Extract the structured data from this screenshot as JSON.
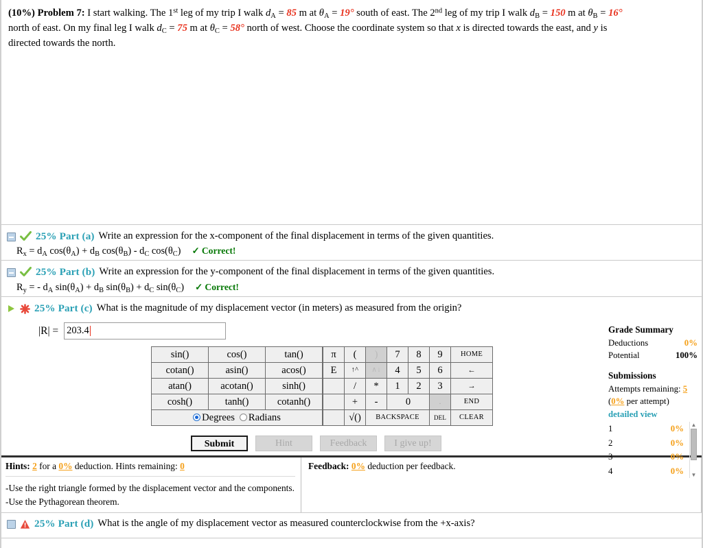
{
  "problem": {
    "percent": "(10%)",
    "label": "Problem 7:",
    "line1_a": "I start walking. The 1",
    "line1_sup1": "st",
    "line1_b": " leg of my trip I walk ",
    "dA": "d",
    "subA": "A",
    "eq": " = ",
    "valA": "85",
    "m_at": " m at ",
    "thetaA": "θ",
    "valThetaA": "19°",
    "dir1": " south of east. The 2",
    "line1_sup2": "nd",
    "line1_c": " leg of my trip I walk ",
    "dB": "d",
    "subB": "B",
    "valB": "150",
    "valThetaB": "16°",
    "line2_a": "north of east. On my final leg I walk ",
    "dC": "d",
    "subC": "C",
    "valC": "75",
    "valThetaC": "58°",
    "line2_b": " north of west. Choose the coordinate system so that ",
    "x_it": "x",
    "line2_c": " is directed towards the east, and ",
    "y_it": "y",
    "line2_d": " is",
    "line3": "directed towards the north."
  },
  "parts": {
    "a": {
      "pct": "25% Part (a)",
      "question": "Write an expression for the x-component of the final displacement in terms of the given quantities.",
      "formula_lhs": "R",
      "formula_sub": "x",
      "formula_rhs": " = d",
      "answer_text": "R_x = d_A cos(θ_A) + d_B cos(θ_B) - d_C cos(θ_C)",
      "status": "Correct!",
      "status_icon": "green-check-icon",
      "toggle_icon": "collapse-box-minus-icon"
    },
    "b": {
      "pct": "25% Part (b)",
      "question": "Write an expression for the y-component of the final displacement in terms of the given quantities.",
      "answer_text": "R_y = - d_A sin(θ_A) + d_B sin(θ_B) + d_C sin(θ_C)",
      "status": "Correct!",
      "status_icon": "green-check-icon",
      "toggle_icon": "collapse-box-minus-icon"
    },
    "c": {
      "pct": "25% Part (c)",
      "question": "What is the magnitude of my displacement vector (in meters) as measured from the origin?",
      "answer_label": "|R| =",
      "answer_value": "203.4",
      "status_icon": "red-x-icon",
      "toggle_icon": "expand-triangle-icon"
    },
    "d": {
      "pct": "25% Part (d)",
      "question": "What is the angle of my displacement vector as measured counterclockwise from the +x-axis?",
      "status_icon": "red-warning-icon",
      "toggle_icon": "collapse-box-icon"
    }
  },
  "calculator": {
    "functions": [
      [
        "sin()",
        "cos()",
        "tan()"
      ],
      [
        "cotan()",
        "asin()",
        "acos()"
      ],
      [
        "atan()",
        "acotan()",
        "sinh()"
      ],
      [
        "cosh()",
        "tanh()",
        "cotanh()"
      ]
    ],
    "angle_mode": {
      "degrees_label": "Degrees",
      "radians_label": "Radians",
      "selected": "Degrees"
    },
    "keys": {
      "pi": "π",
      "e": "E",
      "lparen": "(",
      "rparen": ")",
      "up_caret": "↑^",
      "down_caret": "∧↓",
      "divide": "/",
      "multiply": "*",
      "plus": "+",
      "minus": "-",
      "sqrt": "√()",
      "dot": ".",
      "zero": "0",
      "digits_row1": [
        "7",
        "8",
        "9"
      ],
      "digits_row2": [
        "4",
        "5",
        "6"
      ],
      "digits_row3": [
        "1",
        "2",
        "3"
      ],
      "home": "HOME",
      "left": "←",
      "right": "→",
      "end": "END",
      "backspace": "BACKSPACE",
      "del": "DEL",
      "clear": "CLEAR"
    }
  },
  "actions": {
    "submit": "Submit",
    "hint": "Hint",
    "feedback": "Feedback",
    "give_up": "I give up!"
  },
  "grade_summary": {
    "title": "Grade Summary",
    "deductions_label": "Deductions",
    "deductions_value": "0%",
    "potential_label": "Potential",
    "potential_value": "100%",
    "submissions_title": "Submissions",
    "attempts_label": "Attempts remaining:",
    "attempts_value": "5",
    "per_attempt_pct": "0%",
    "per_attempt_text": " per attempt)",
    "per_attempt_open": "(",
    "detailed_view": "detailed view",
    "rows": [
      {
        "n": "1",
        "pct": "0%"
      },
      {
        "n": "2",
        "pct": "0%"
      },
      {
        "n": "3",
        "pct": "0%"
      },
      {
        "n": "4",
        "pct": "0%"
      }
    ]
  },
  "hints": {
    "label": "Hints:",
    "count": "2",
    "for_a": " for a ",
    "deduction_pct": "0%",
    "deduction_text": " deduction. Hints remaining: ",
    "remaining": "0",
    "lines": [
      "-Use the right triangle formed by the displacement vector and the components.",
      "-Use the Pythagorean theorem."
    ]
  },
  "feedback": {
    "label": "Feedback:",
    "pct": "0%",
    "text": " deduction per feedback."
  }
}
